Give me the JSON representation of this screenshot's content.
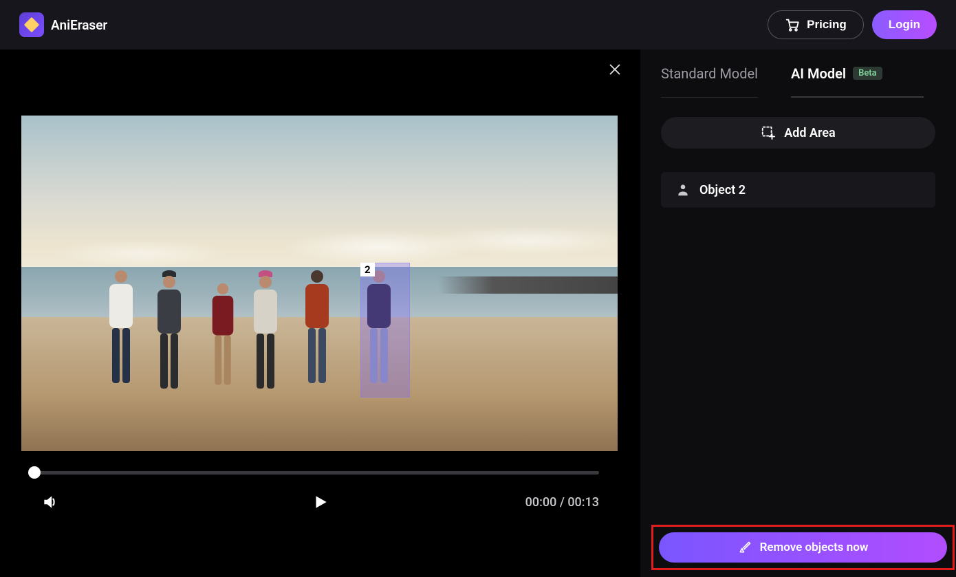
{
  "header": {
    "app_name": "AniEraser",
    "pricing_label": "Pricing",
    "login_label": "Login"
  },
  "viewer": {
    "selection_label": "2",
    "time_current": "00:00",
    "time_total": "00:13"
  },
  "sidebar": {
    "tabs": {
      "standard": "Standard Model",
      "ai": "AI Model",
      "badge": "Beta",
      "active": "ai"
    },
    "add_area_label": "Add Area",
    "object_label": "Object 2",
    "remove_label": "Remove objects now"
  },
  "colors": {
    "accent_start": "#7a56ff",
    "accent_end": "#b14dff",
    "highlight_border": "#e21b1b"
  }
}
